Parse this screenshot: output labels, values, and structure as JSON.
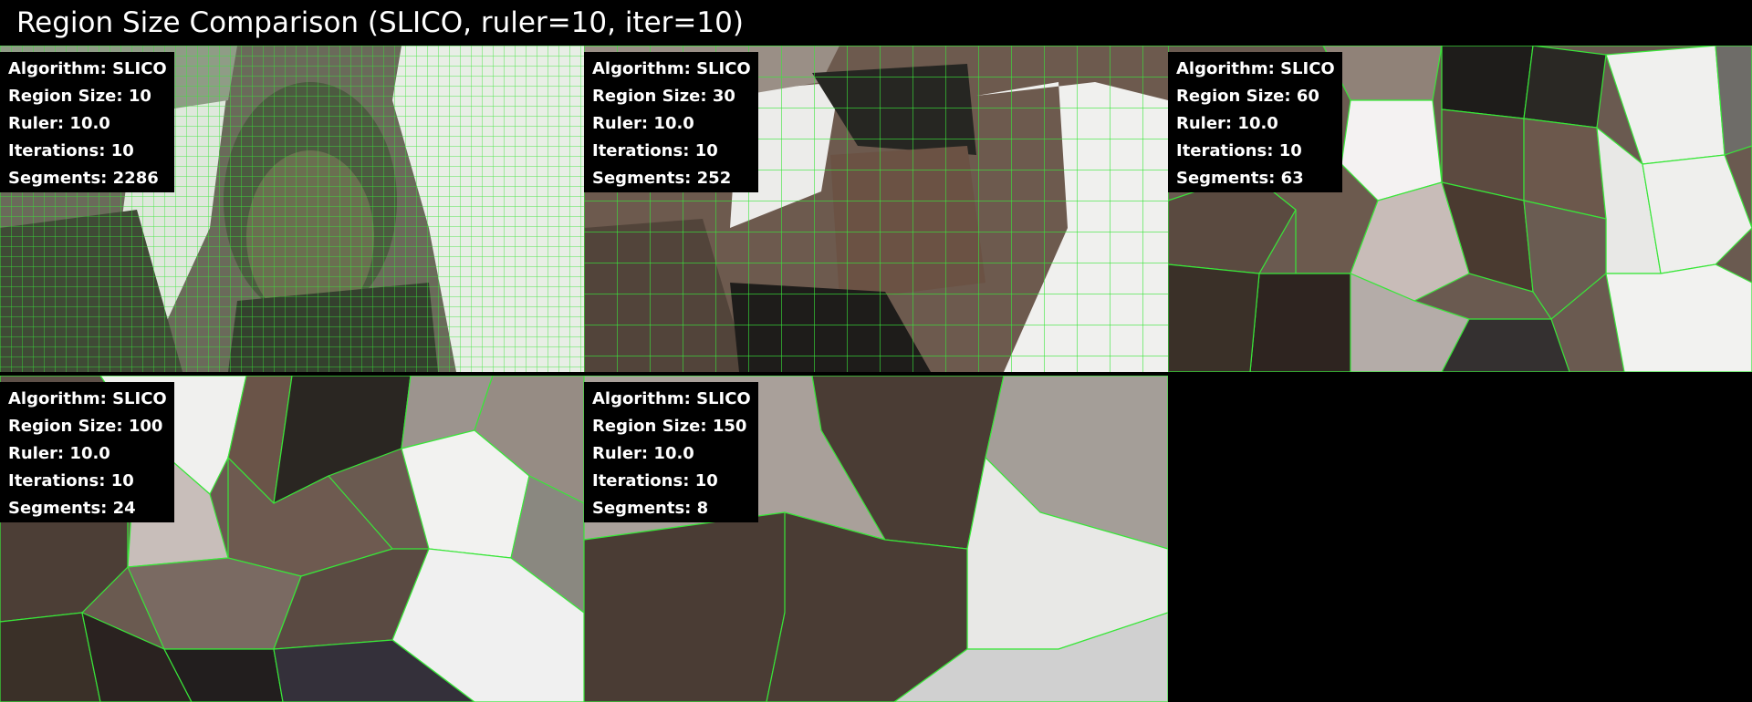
{
  "title": "Region Size Comparison (SLICO, ruler=10, iter=10)",
  "info_labels": {
    "algorithm": "Algorithm:",
    "region_size": "Region Size:",
    "ruler": "Ruler:",
    "iterations": "Iterations:",
    "segments": "Segments:"
  },
  "panels": [
    {
      "algorithm": "SLICO",
      "region_size": "10",
      "ruler": "10.0",
      "iterations": "10",
      "segments": "2286"
    },
    {
      "algorithm": "SLICO",
      "region_size": "30",
      "ruler": "10.0",
      "iterations": "10",
      "segments": "252"
    },
    {
      "algorithm": "SLICO",
      "region_size": "60",
      "ruler": "10.0",
      "iterations": "10",
      "segments": "63"
    },
    {
      "algorithm": "SLICO",
      "region_size": "100",
      "ruler": "10.0",
      "iterations": "10",
      "segments": "24"
    },
    {
      "algorithm": "SLICO",
      "region_size": "150",
      "ruler": "10.0",
      "iterations": "10",
      "segments": "8"
    }
  ],
  "colors": {
    "background": "#000000",
    "boundary": "#39e639",
    "text": "#ffffff",
    "light_region": "#eeeeee",
    "dark_region": "#3a3028",
    "mid_region": "#6f5a4e"
  }
}
